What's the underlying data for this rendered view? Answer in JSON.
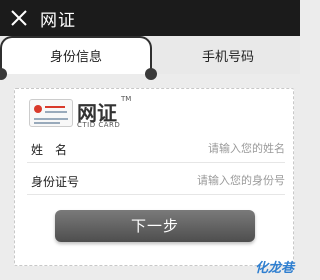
{
  "header": {
    "title": "网证",
    "close_icon": "close-icon"
  },
  "tabs": [
    {
      "label": "身份信息",
      "active": true
    },
    {
      "label": "手机号码",
      "active": false
    }
  ],
  "card": {
    "brand_name": "网证",
    "brand_tm": "TM",
    "brand_sub": "CTID CARD",
    "fields": [
      {
        "label": "姓　名",
        "placeholder": "请输入您的姓名",
        "value": ""
      },
      {
        "label": "身份证号",
        "placeholder": "请输入您的身份号",
        "value": ""
      }
    ],
    "next_button": "下一步"
  },
  "watermark": "化龙巷",
  "colors": {
    "titlebar": "#1b1b1b",
    "button": "#5e5e5e",
    "watermark": "#2f7fd0"
  }
}
